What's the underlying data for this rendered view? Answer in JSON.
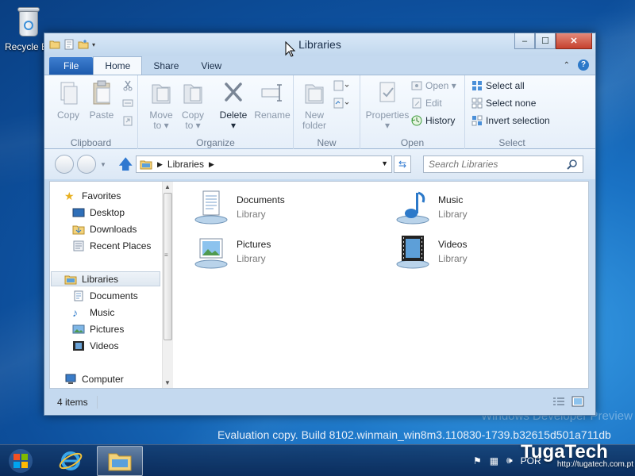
{
  "desktop": {
    "recycle_bin_label": "Recycle Bin",
    "watermark_line1": "Windows Developer Preview",
    "watermark_line2": "Evaluation copy. Build 8102.winmain_win8m3.110830-1739.b32615d501a711db",
    "brand": "TugaTech",
    "brand_url": "http://tugatech.com.pt"
  },
  "window": {
    "title": "Libraries",
    "caption": {
      "minimize": "–",
      "maximize": "☐",
      "close": "✕"
    }
  },
  "ribbon": {
    "tabs": [
      {
        "label": "File"
      },
      {
        "label": "Home"
      },
      {
        "label": "Share"
      },
      {
        "label": "View"
      }
    ],
    "groups": {
      "clipboard": {
        "label": "Clipboard",
        "copy": "Copy",
        "paste": "Paste"
      },
      "organize": {
        "label": "Organize",
        "move_to": "Move",
        "move_to_2": "to ▾",
        "copy_to": "Copy",
        "copy_to_2": "to ▾",
        "delete": "Delete",
        "delete_2": "▾",
        "rename": "Rename"
      },
      "new": {
        "label": "New",
        "new_folder": "New",
        "new_folder_2": "folder"
      },
      "open": {
        "label": "Open",
        "properties": "Properties",
        "properties_2": "▾",
        "open": "Open ▾",
        "edit": "Edit",
        "history": "History"
      },
      "select": {
        "label": "Select",
        "select_all": "Select all",
        "select_none": "Select none",
        "invert_selection": "Invert selection"
      }
    }
  },
  "address": {
    "path": "Libraries",
    "search_placeholder": "Search Libraries"
  },
  "nav": {
    "favorites": "Favorites",
    "desktop": "Desktop",
    "downloads": "Downloads",
    "recent_places": "Recent Places",
    "libraries": "Libraries",
    "documents": "Documents",
    "music": "Music",
    "pictures": "Pictures",
    "videos": "Videos",
    "computer": "Computer"
  },
  "content": {
    "items": [
      {
        "name": "Documents",
        "type": "Library",
        "icon": "documents-library-icon"
      },
      {
        "name": "Music",
        "type": "Library",
        "icon": "music-library-icon"
      },
      {
        "name": "Pictures",
        "type": "Library",
        "icon": "pictures-library-icon"
      },
      {
        "name": "Videos",
        "type": "Library",
        "icon": "videos-library-icon"
      }
    ]
  },
  "status": {
    "item_count": "4 items"
  },
  "taskbar": {
    "tray_lang": "POR"
  },
  "colors": {
    "accent": "#2c79c9",
    "file_tab": "#1c5aad",
    "close": "#c6412e"
  }
}
